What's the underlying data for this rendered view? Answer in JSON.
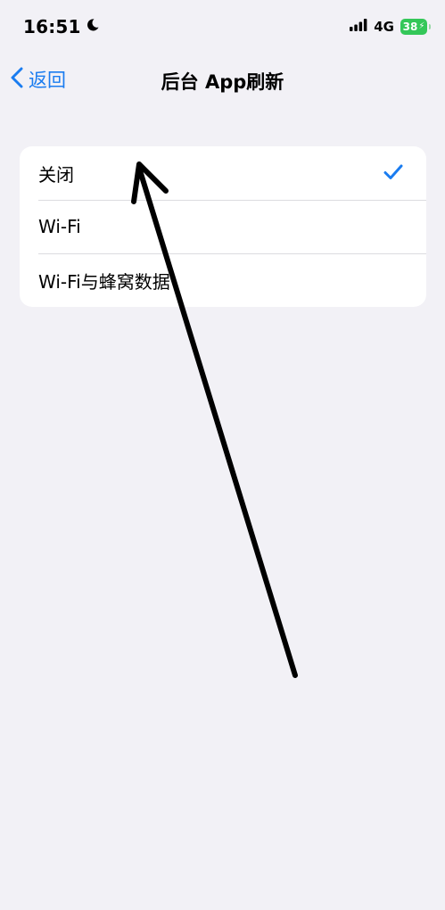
{
  "status_bar": {
    "time": "16:51",
    "network": "4G",
    "battery": "38",
    "icons": [
      "moon-icon",
      "signal-icon",
      "battery-charging-icon"
    ]
  },
  "nav": {
    "back_label": "返回",
    "title": "后台 App刷新",
    "back_icon": "chevron-left-icon"
  },
  "options": [
    {
      "label": "关闭",
      "selected": true
    },
    {
      "label": "Wi-Fi",
      "selected": false
    },
    {
      "label": "Wi-Fi与蜂窝数据",
      "selected": false
    }
  ],
  "colors": {
    "accent": "#1a7cf0",
    "background": "#f2f1f6",
    "battery": "#34c759"
  }
}
